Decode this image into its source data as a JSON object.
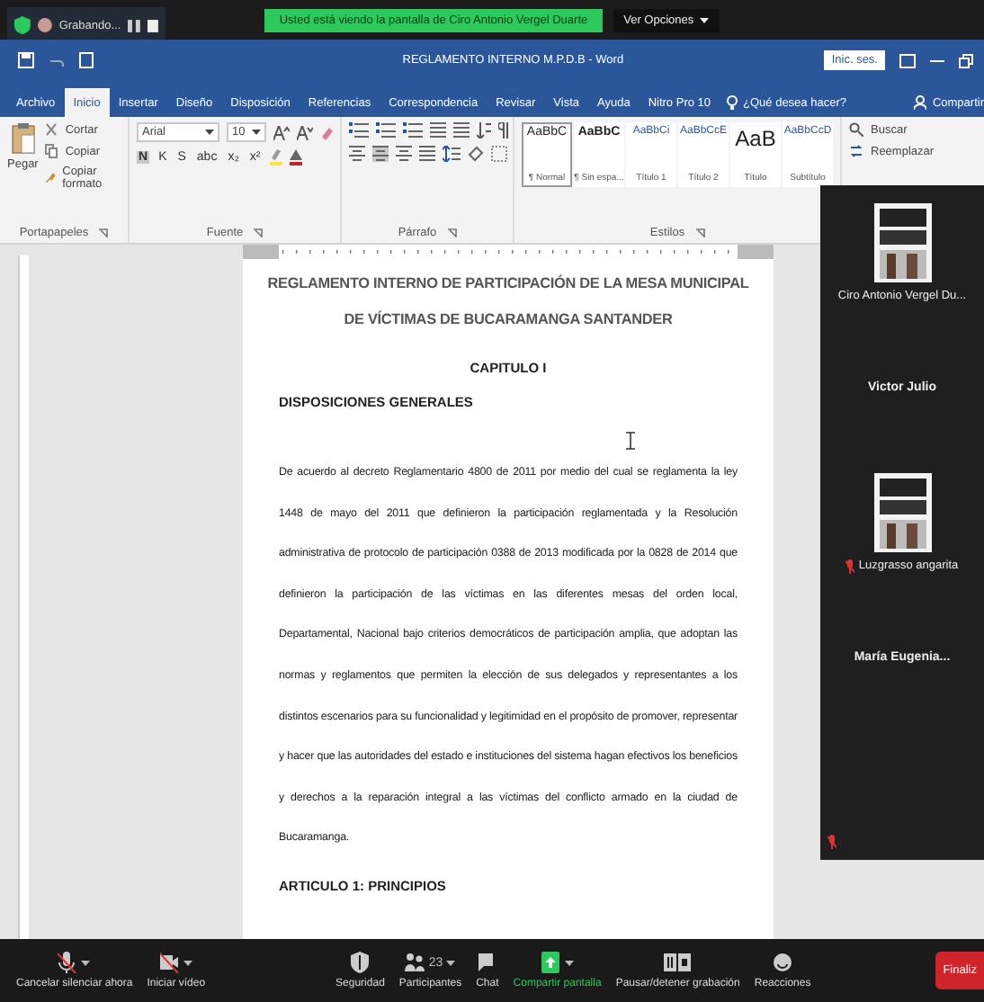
{
  "zoom_banner": {
    "recording": "Grabando...",
    "viewing": "Usted está viendo la pantalla de Ciro Antonio Vergel Duarte",
    "view_options": "Ver Opciones"
  },
  "window": {
    "title": "REGLAMENTO INTERNO M.P.D.B - Word",
    "sign_in": "Inic. ses."
  },
  "tabs": [
    {
      "label": "Archivo",
      "selected": false
    },
    {
      "label": "Inicio",
      "selected": true
    },
    {
      "label": "Insertar",
      "selected": false
    },
    {
      "label": "Diseño",
      "selected": false
    },
    {
      "label": "Disposición",
      "selected": false
    },
    {
      "label": "Referencias",
      "selected": false
    },
    {
      "label": "Correspondencia",
      "selected": false
    },
    {
      "label": "Revisar",
      "selected": false
    },
    {
      "label": "Vista",
      "selected": false
    },
    {
      "label": "Ayuda",
      "selected": false
    },
    {
      "label": "Nitro Pro 10",
      "selected": false
    }
  ],
  "tell_me": "¿Qué desea hacer?",
  "share": "Compartir",
  "ribbon": {
    "clipboard": {
      "paste": "Pegar",
      "items": [
        "Cortar",
        "Copiar",
        "Copiar formato"
      ],
      "label": "Portapapeles"
    },
    "font": {
      "name": "Arial",
      "size": "10",
      "format_buttons": [
        "N",
        "K",
        "S",
        "abc",
        "x₂",
        "x²"
      ],
      "label": "Fuente"
    },
    "paragraph": {
      "label": "Párrafo"
    },
    "styles": {
      "label": "Estilos",
      "items": [
        {
          "sample": "AaBbC",
          "name": "¶ Normal",
          "selected": true
        },
        {
          "sample": "AaBbC",
          "name": "¶ Sin espa...",
          "selected": false
        },
        {
          "sample": "AaBbCi",
          "name": "Título 1",
          "selected": false
        },
        {
          "sample": "AaBbCcE",
          "name": "Título 2",
          "selected": false
        },
        {
          "sample": "AaB",
          "name": "Título",
          "selected": false
        },
        {
          "sample": "AaBbCcD",
          "name": "Subtítulo",
          "selected": false
        }
      ]
    },
    "editing": {
      "items": [
        "Buscar",
        "Reemplazar"
      ]
    }
  },
  "document": {
    "title": "REGLAMENTO INTERNO DE PARTICIPACIÓN DE LA MESA MUNICIPAL DE VÍCTIMAS DE BUCARAMANGA SANTANDER",
    "chapter": "CAPITULO I",
    "section": "DISPOSICIONES GENERALES",
    "paragraph": "De acuerdo al decreto Reglamentario 4800 de 2011 por medio del cual se reglamenta la ley 1448 de mayo del 2011 que definieron la participación reglamentada y la Resolución administrativa de protocolo de participación 0388 de 2013 modificada por la 0828 de 2014 que definieron la participación de las víctimas en las diferentes mesas del orden local, Departamental, Nacional bajo criterios democráticos de participación amplia, que adoptan las normas y reglamentos que permiten la elección de sus delegados y representantes a los distintos escenarios para su funcionalidad y legitimidad en el propósito de promover, representar y hacer que las autoridades del estado e instituciones del sistema hagan efectivos los beneficios y derechos a la reparación integral a las víctimas del conflicto armado en la ciudad de Bucaramanga.",
    "article": "ARTICULO 1: PRINCIPIOS"
  },
  "participants": [
    {
      "kind": "picture",
      "name": "Ciro Antonio Vergel Du...",
      "muted": false
    },
    {
      "kind": "name",
      "name": "Victor Julio",
      "muted": false
    },
    {
      "kind": "picture",
      "name": "Luzgrasso angarita",
      "muted": true
    },
    {
      "kind": "name",
      "name": "María Eugenia...",
      "muted": false
    },
    {
      "kind": "blank",
      "muted": true
    }
  ],
  "toolbar": [
    {
      "kind": "mic",
      "label": "Cancelar silenciar ahora",
      "caret": true,
      "active": false
    },
    {
      "kind": "video",
      "label": "Iniciar vídeo",
      "caret": true,
      "active": false
    },
    {
      "kind": "shield",
      "label": "Seguridad",
      "caret": false,
      "active": false
    },
    {
      "kind": "people",
      "label": "Participantes",
      "count": "23",
      "caret": true,
      "active": false
    },
    {
      "kind": "chat",
      "label": "Chat",
      "caret": false,
      "active": false
    },
    {
      "kind": "share",
      "label": "Compartir pantalla",
      "caret": true,
      "active": true
    },
    {
      "kind": "record",
      "label": "Pausar/detener grabación",
      "caret": false,
      "active": false
    },
    {
      "kind": "smile",
      "label": "Reacciones",
      "caret": false,
      "active": false
    }
  ],
  "end_button": "Finaliz"
}
